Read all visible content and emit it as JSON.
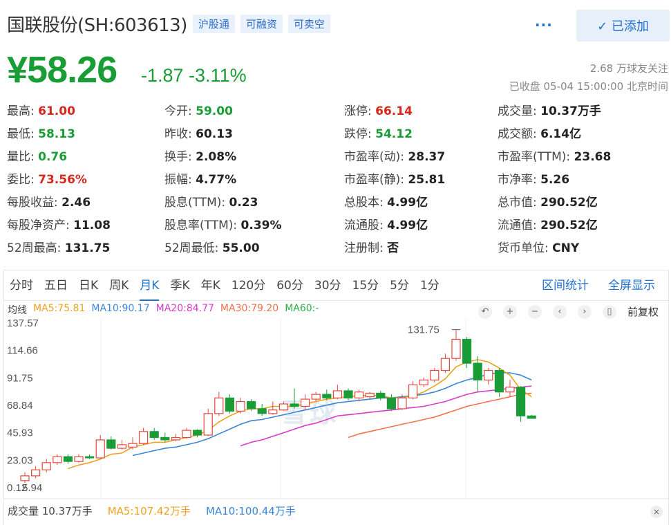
{
  "header": {
    "name": "国联股份(SH:603613)",
    "badges": [
      "沪股通",
      "可融资",
      "可卖空"
    ],
    "more": "···",
    "add_button": "✓ 已添加"
  },
  "quote": {
    "price": "¥58.26",
    "change": "-1.87 -3.11%",
    "followers": "2.68 万球友关注",
    "status": "已收盘 05-04 15:00:00 北京时间"
  },
  "stats": [
    [
      {
        "label": "最高:",
        "value": "61.00",
        "color": "red"
      },
      {
        "label": "今开:",
        "value": "59.00",
        "color": "green"
      },
      {
        "label": "涨停:",
        "value": "66.14",
        "color": "red"
      },
      {
        "label": "成交量:",
        "value": "10.37万手",
        "color": ""
      }
    ],
    [
      {
        "label": "最低:",
        "value": "58.13",
        "color": "green"
      },
      {
        "label": "昨收:",
        "value": "60.13",
        "color": ""
      },
      {
        "label": "跌停:",
        "value": "54.12",
        "color": "green"
      },
      {
        "label": "成交额:",
        "value": "6.14亿",
        "color": ""
      }
    ],
    [
      {
        "label": "量比:",
        "value": "0.76",
        "color": "green"
      },
      {
        "label": "换手:",
        "value": "2.08%",
        "color": ""
      },
      {
        "label": "市盈率(动):",
        "value": "28.37",
        "color": ""
      },
      {
        "label": "市盈率(TTM):",
        "value": "23.68",
        "color": ""
      }
    ],
    [
      {
        "label": "委比:",
        "value": "73.56%",
        "color": "red"
      },
      {
        "label": "振幅:",
        "value": "4.77%",
        "color": ""
      },
      {
        "label": "市盈率(静):",
        "value": "25.81",
        "color": ""
      },
      {
        "label": "市净率:",
        "value": "5.26",
        "color": ""
      }
    ],
    [
      {
        "label": "每股收益:",
        "value": "2.46",
        "color": ""
      },
      {
        "label": "股息(TTM):",
        "value": "0.23",
        "color": ""
      },
      {
        "label": "总股本:",
        "value": "4.99亿",
        "color": ""
      },
      {
        "label": "总市值:",
        "value": "290.52亿",
        "color": ""
      }
    ],
    [
      {
        "label": "每股净资产:",
        "value": "11.08",
        "color": ""
      },
      {
        "label": "股息率(TTM):",
        "value": "0.39%",
        "color": ""
      },
      {
        "label": "流通股:",
        "value": "4.99亿",
        "color": ""
      },
      {
        "label": "流通值:",
        "value": "290.52亿",
        "color": ""
      }
    ],
    [
      {
        "label": "52周最高:",
        "value": "131.75",
        "color": ""
      },
      {
        "label": "52周最低:",
        "value": "55.00",
        "color": ""
      },
      {
        "label": "注册制:",
        "value": "否",
        "color": ""
      },
      {
        "label": "货币单位:",
        "value": "CNY",
        "color": ""
      }
    ]
  ],
  "tabs": [
    "分时",
    "五日",
    "日K",
    "周K",
    "月K",
    "季K",
    "年K",
    "120分",
    "60分",
    "30分",
    "15分",
    "5分",
    "1分"
  ],
  "active_tab": "月K",
  "tab_links": {
    "range": "区间统计",
    "fullscreen": "全屏显示"
  },
  "ma": {
    "label": "均线",
    "items": [
      {
        "text": "MA5:75.81",
        "color": "#f0a020"
      },
      {
        "text": "MA10:90.17",
        "color": "#3a86d6"
      },
      {
        "text": "MA20:84.77",
        "color": "#d63cc8"
      },
      {
        "text": "MA30:79.20",
        "color": "#f0704a"
      },
      {
        "text": "MA60:-",
        "color": "#2bb04a"
      }
    ]
  },
  "tools": {
    "icons": [
      "↶",
      "+",
      "−",
      "‹",
      "›",
      "▯"
    ],
    "adjust": "前复权"
  },
  "watermark": "雪球",
  "volume": {
    "label": "成交量 10.37万手",
    "ma5": "MA5:107.42万手",
    "ma10": "MA10:100.44万手",
    "close": "×"
  },
  "chart_data": {
    "type": "candlestick",
    "y_ticks": [
      "137.57",
      "114.66",
      "91.75",
      "68.84",
      "45.93",
      "23.03",
      "0.12"
    ],
    "bottom_label": "5.94",
    "max_label": "131.75",
    "ylim": [
      0.12,
      137.57
    ],
    "colors": {
      "up": "#e8453c",
      "down": "#1a9d36"
    },
    "candles": [
      {
        "o": 6,
        "c": 10,
        "h": 13,
        "l": 4
      },
      {
        "o": 10,
        "c": 15,
        "h": 18,
        "l": 8
      },
      {
        "o": 15,
        "c": 21,
        "h": 24,
        "l": 13
      },
      {
        "o": 21,
        "c": 26,
        "h": 28,
        "l": 19
      },
      {
        "o": 26,
        "c": 22,
        "h": 28,
        "l": 20
      },
      {
        "o": 22,
        "c": 26,
        "h": 28,
        "l": 21
      },
      {
        "o": 26,
        "c": 25,
        "h": 28,
        "l": 24
      },
      {
        "o": 25,
        "c": 40,
        "h": 44,
        "l": 24
      },
      {
        "o": 40,
        "c": 33,
        "h": 43,
        "l": 32
      },
      {
        "o": 33,
        "c": 36,
        "h": 40,
        "l": 32
      },
      {
        "o": 34,
        "c": 37,
        "h": 42,
        "l": 32
      },
      {
        "o": 37,
        "c": 47,
        "h": 50,
        "l": 36
      },
      {
        "o": 47,
        "c": 42,
        "h": 50,
        "l": 40
      },
      {
        "o": 42,
        "c": 40,
        "h": 46,
        "l": 38
      },
      {
        "o": 40,
        "c": 42,
        "h": 45,
        "l": 39
      },
      {
        "o": 42,
        "c": 48,
        "h": 50,
        "l": 41
      },
      {
        "o": 48,
        "c": 44,
        "h": 49,
        "l": 42
      },
      {
        "o": 44,
        "c": 62,
        "h": 66,
        "l": 43
      },
      {
        "o": 62,
        "c": 75,
        "h": 80,
        "l": 60
      },
      {
        "o": 75,
        "c": 64,
        "h": 78,
        "l": 62
      },
      {
        "o": 64,
        "c": 72,
        "h": 75,
        "l": 62
      },
      {
        "o": 72,
        "c": 66,
        "h": 74,
        "l": 64
      },
      {
        "o": 66,
        "c": 62,
        "h": 70,
        "l": 60
      },
      {
        "o": 62,
        "c": 65,
        "h": 72,
        "l": 61
      },
      {
        "o": 65,
        "c": 70,
        "h": 72,
        "l": 64
      },
      {
        "o": 70,
        "c": 68,
        "h": 83,
        "l": 66
      },
      {
        "o": 68,
        "c": 74,
        "h": 78,
        "l": 65
      },
      {
        "o": 74,
        "c": 78,
        "h": 80,
        "l": 72
      },
      {
        "o": 78,
        "c": 75,
        "h": 82,
        "l": 73
      },
      {
        "o": 75,
        "c": 81,
        "h": 86,
        "l": 74
      },
      {
        "o": 81,
        "c": 75,
        "h": 83,
        "l": 73
      },
      {
        "o": 75,
        "c": 80,
        "h": 82,
        "l": 72
      },
      {
        "o": 76,
        "c": 79,
        "h": 80,
        "l": 74
      },
      {
        "o": 79,
        "c": 75,
        "h": 81,
        "l": 73
      },
      {
        "o": 75,
        "c": 66,
        "h": 78,
        "l": 64
      },
      {
        "o": 66,
        "c": 75,
        "h": 78,
        "l": 65
      },
      {
        "o": 75,
        "c": 86,
        "h": 89,
        "l": 74
      },
      {
        "o": 86,
        "c": 90,
        "h": 92,
        "l": 84
      },
      {
        "o": 90,
        "c": 98,
        "h": 100,
        "l": 88
      },
      {
        "o": 98,
        "c": 108,
        "h": 112,
        "l": 96
      },
      {
        "o": 108,
        "c": 124,
        "h": 132,
        "l": 106
      },
      {
        "o": 124,
        "c": 104,
        "h": 126,
        "l": 100
      },
      {
        "o": 104,
        "c": 90,
        "h": 110,
        "l": 80
      },
      {
        "o": 90,
        "c": 98,
        "h": 100,
        "l": 86
      },
      {
        "o": 98,
        "c": 80,
        "h": 100,
        "l": 76
      },
      {
        "o": 80,
        "c": 84,
        "h": 90,
        "l": 76
      },
      {
        "o": 84,
        "c": 60,
        "h": 85,
        "l": 55
      },
      {
        "o": 60,
        "c": 58,
        "h": 61,
        "l": 58
      }
    ],
    "ma5": [
      null,
      null,
      null,
      null,
      16,
      19,
      21,
      24,
      28,
      29,
      34,
      36,
      38,
      38,
      40,
      42,
      44,
      48,
      55,
      60,
      64,
      66,
      66,
      68,
      68,
      68,
      70,
      72,
      74,
      75,
      76,
      77,
      77,
      77,
      75,
      75,
      77,
      80,
      85,
      91,
      101,
      105,
      107,
      105,
      100,
      94,
      82,
      76
    ],
    "ma10": [
      null,
      null,
      null,
      null,
      null,
      null,
      null,
      null,
      null,
      null,
      27,
      29,
      31,
      33,
      34,
      36,
      38,
      41,
      45,
      49,
      53,
      56,
      57,
      59,
      61,
      63,
      65,
      67,
      69,
      71,
      72,
      73,
      74,
      75,
      75,
      76,
      77,
      78,
      80,
      83,
      87,
      90,
      92,
      95,
      96,
      96,
      94,
      90
    ],
    "ma20": [
      null,
      null,
      null,
      null,
      null,
      null,
      null,
      null,
      null,
      null,
      null,
      null,
      null,
      null,
      null,
      null,
      null,
      null,
      null,
      null,
      35,
      38,
      40,
      43,
      46,
      49,
      52,
      54,
      57,
      60,
      61,
      62,
      63,
      64,
      65,
      66,
      67,
      68,
      70,
      72,
      75,
      78,
      80,
      81,
      82,
      83,
      84,
      85
    ],
    "ma30": [
      null,
      null,
      null,
      null,
      null,
      null,
      null,
      null,
      null,
      null,
      null,
      null,
      null,
      null,
      null,
      null,
      null,
      null,
      null,
      null,
      null,
      null,
      null,
      null,
      null,
      null,
      null,
      null,
      null,
      null,
      42,
      45,
      47,
      49,
      51,
      53,
      55,
      57,
      59,
      62,
      65,
      68,
      70,
      72,
      74,
      76,
      78,
      79
    ]
  }
}
